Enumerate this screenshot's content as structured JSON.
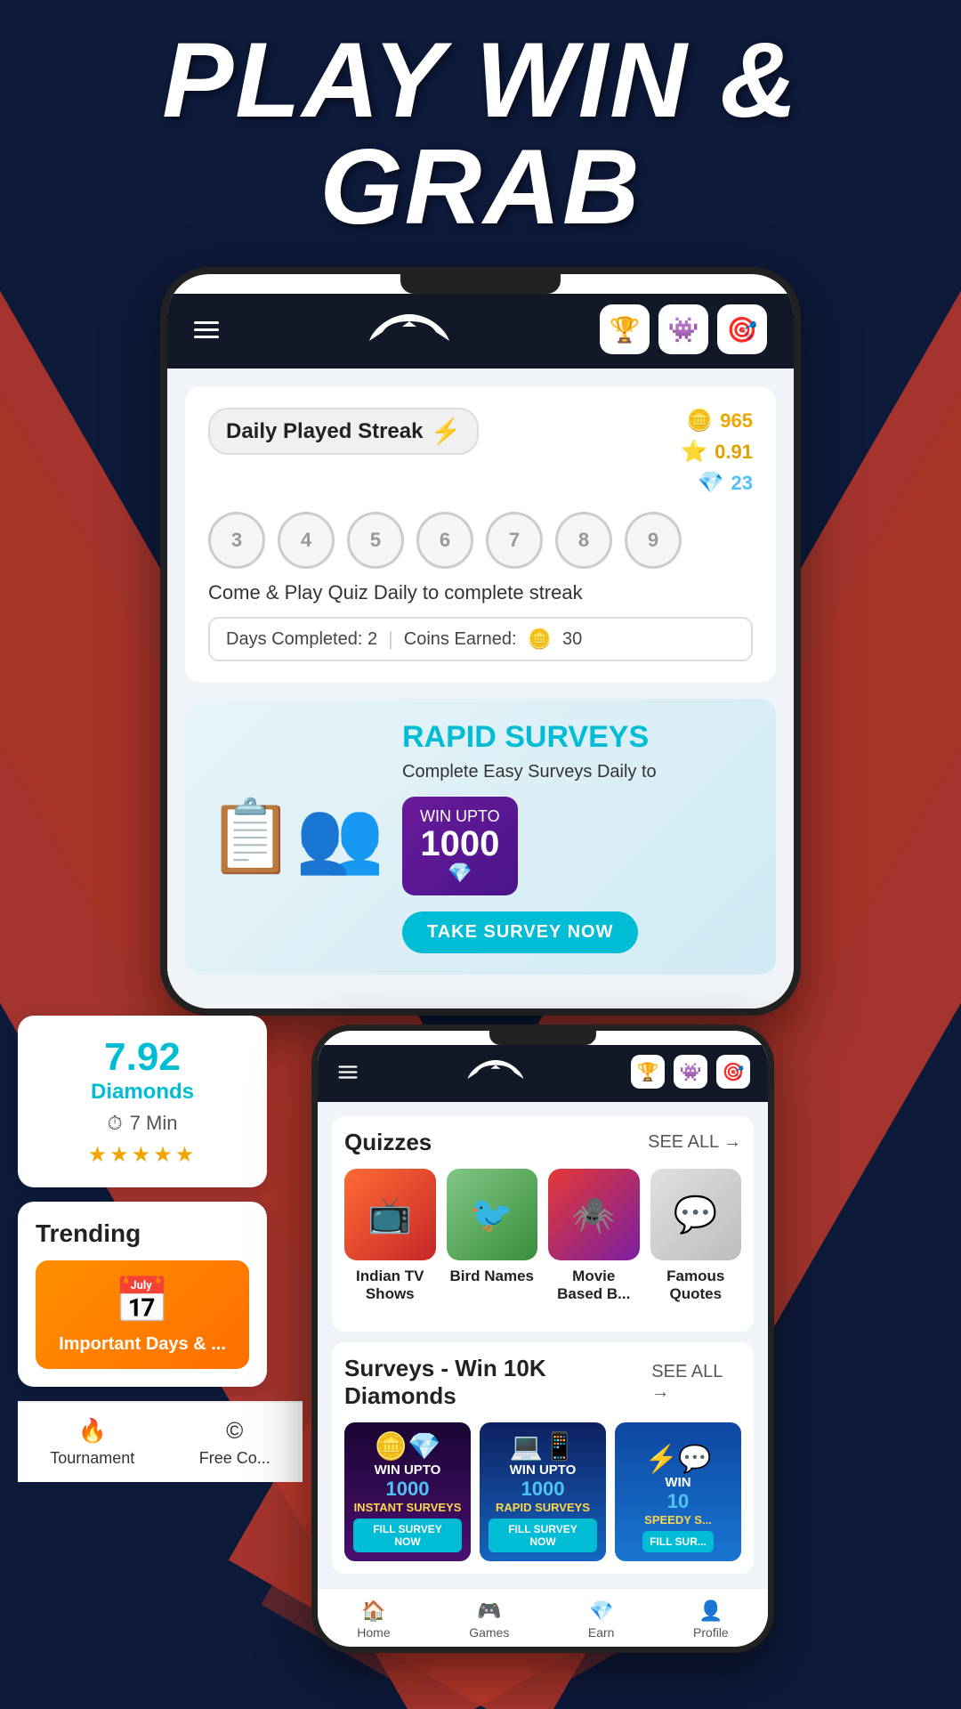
{
  "hero": {
    "title": "PLAY WIN & GRAB"
  },
  "phone1": {
    "nav": {
      "logo_alt": "Winzo logo",
      "icon1": "🏆",
      "icon2": "👾",
      "icon3": "🎯"
    },
    "streak": {
      "title": "Daily Played Streak",
      "lightning": "⚡",
      "coins": "965",
      "stars": "0.91",
      "diamonds": "23",
      "circles": [
        "3",
        "4",
        "5",
        "6",
        "7",
        "8",
        "9"
      ],
      "description": "Come & Play Quiz Daily to complete streak",
      "days_completed": "Days Completed: 2",
      "coins_earned": "Coins Earned:",
      "coins_earned_value": "30"
    },
    "survey_banner": {
      "title": "RAPID",
      "title2": "SURVEYS",
      "subtitle": "Complete Easy Surveys Daily to",
      "win_label": "WIN UPTO",
      "win_amount": "1000",
      "button": "TAKE SURVEY NOW"
    }
  },
  "phone2": {
    "nav": {
      "icon1": "🏆",
      "icon2": "👾",
      "icon3": "🎯"
    },
    "quizzes": {
      "title": "Quizzes",
      "see_all": "SEE ALL →",
      "items": [
        {
          "label": "Indian TV Shows",
          "icon": "📺"
        },
        {
          "label": "Bird Names",
          "icon": "🐦"
        },
        {
          "label": "Movie Based B...",
          "icon": "🕷️"
        },
        {
          "label": "Famous Quotes",
          "icon": "💬"
        }
      ]
    },
    "surveys": {
      "title": "Surveys - Win 10K Diamonds",
      "see_all": "SEE ALL →",
      "items": [
        {
          "type": "INSTANT SURVEYS",
          "win": "WIN UPTO",
          "amount": "1000",
          "btn": "FILL SURVEY NOW"
        },
        {
          "type": "RAPID SURVEYS",
          "win": "WIN UPTO",
          "amount": "1000",
          "btn": "FILL SURVEY NOW"
        },
        {
          "type": "SPEEDY S...",
          "win": "WIN",
          "amount": "10",
          "btn": "FILL SUR..."
        }
      ]
    },
    "bottom_nav": [
      {
        "icon": "🏠",
        "label": "Home"
      },
      {
        "icon": "🎮",
        "label": "Games"
      },
      {
        "icon": "💎",
        "label": "Earn"
      },
      {
        "icon": "👤",
        "label": "Profile"
      }
    ]
  },
  "left_panel": {
    "diamond_card": {
      "value": "7.92",
      "label": "Diamonds",
      "time_icon": "⏱",
      "time": "7 Min",
      "stars": "★★★★★"
    },
    "trending": {
      "title": "Trending",
      "item_icon": "📅",
      "item_label": "Important Days & ..."
    },
    "bottom_nav": [
      {
        "icon": "🔥",
        "label": "Tournament"
      },
      {
        "icon": "©",
        "label": "Free Co..."
      }
    ]
  }
}
